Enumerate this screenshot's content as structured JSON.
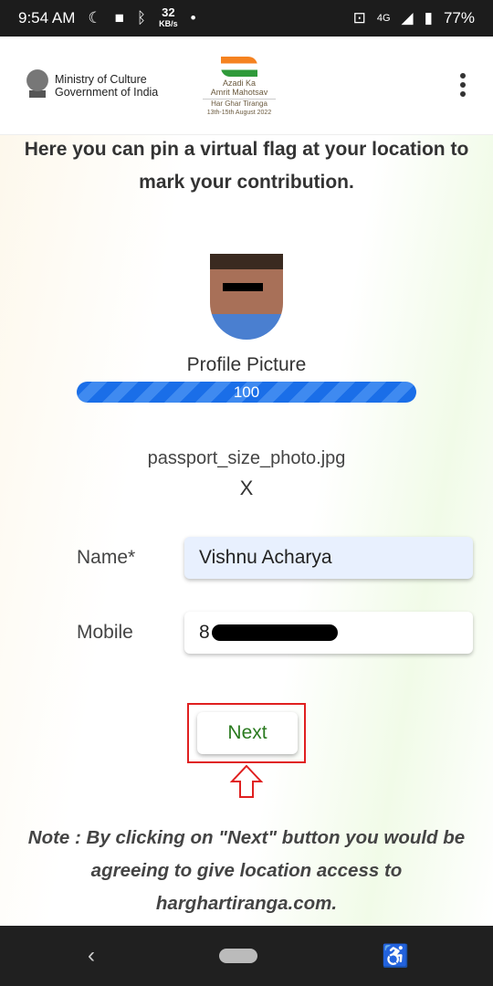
{
  "status_bar": {
    "time": "9:54 AM",
    "net_speed": "32",
    "net_unit": "KB/s",
    "battery": "77%",
    "network": "4G"
  },
  "header": {
    "ministry_line1": "Ministry of Culture",
    "ministry_line2": "Government of India",
    "logo_line1": "Azadi Ka",
    "logo_line2": "Amrit Mahotsav",
    "logo_line3": "Har Ghar Tiranga",
    "logo_line4": "13th-15th August 2022"
  },
  "main": {
    "intro": "Here you can pin a virtual flag at your location to mark your contribution.",
    "profile_label": "Profile Picture",
    "upload_progress": 100,
    "upload_progress_text": "100",
    "file_name": "passport_size_photo.jpg",
    "remove_label": "X",
    "name_label": "Name*",
    "name_value": "Vishnu Acharya",
    "mobile_label": "Mobile",
    "mobile_value_visible": "8",
    "next_label": "Next",
    "note": "Note : By clicking on \"Next\" button you would be agreeing to give location access to harghartiranga.com."
  },
  "colors": {
    "progress": "#1a6ee8",
    "next_text": "#2a7a1f",
    "highlight": "#e02020",
    "field_name_bg": "#e8f0fe"
  }
}
